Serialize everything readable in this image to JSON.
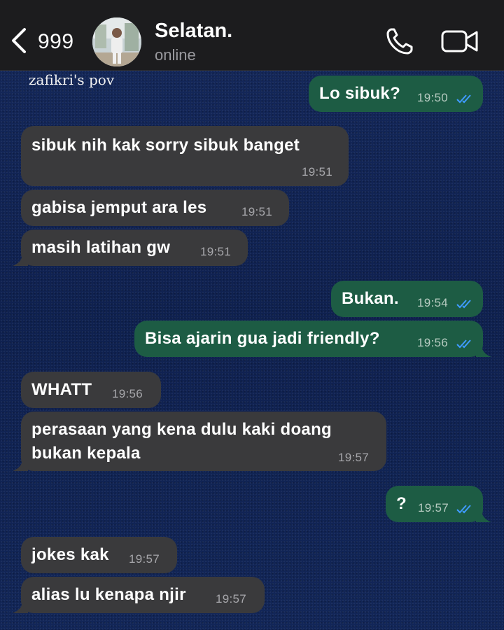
{
  "header": {
    "back_count": "999",
    "contact_name": "Selatan.",
    "status": "online"
  },
  "watermark": "zafikri's pov",
  "messages": [
    {
      "dir": "out",
      "text": "Lo sibuk?",
      "time": "19:50",
      "read": true
    },
    {
      "dir": "in",
      "text": "sibuk nih kak sorry sibuk banget",
      "time": "19:51"
    },
    {
      "dir": "in",
      "text": "gabisa jemput ara les",
      "time": "19:51"
    },
    {
      "dir": "in",
      "text": "masih latihan gw",
      "time": "19:51"
    },
    {
      "dir": "out",
      "text": "Bukan.",
      "time": "19:54",
      "read": true
    },
    {
      "dir": "out",
      "text": "Bisa ajarin gua jadi friendly?",
      "time": "19:56",
      "read": true
    },
    {
      "dir": "in",
      "text": "WHATT",
      "time": "19:56"
    },
    {
      "dir": "in",
      "text": "perasaan yang kena dulu kaki doang",
      "text2": "bukan kepala",
      "time": "19:57"
    },
    {
      "dir": "out",
      "text": "?",
      "time": "19:57",
      "read": true
    },
    {
      "dir": "in",
      "text": "jokes kak",
      "time": "19:57"
    },
    {
      "dir": "in",
      "text": "alias lu kenapa njir",
      "time": "19:57"
    }
  ],
  "colors": {
    "incoming_bubble": "#3a3a3c",
    "outgoing_bubble": "#1d5c44",
    "read_ticks": "#3f9bff",
    "header": "#1c1c1e",
    "wallpaper": "#13275a"
  },
  "icons": {
    "back": "chevron-left-icon",
    "call": "phone-icon",
    "video": "video-camera-icon"
  }
}
